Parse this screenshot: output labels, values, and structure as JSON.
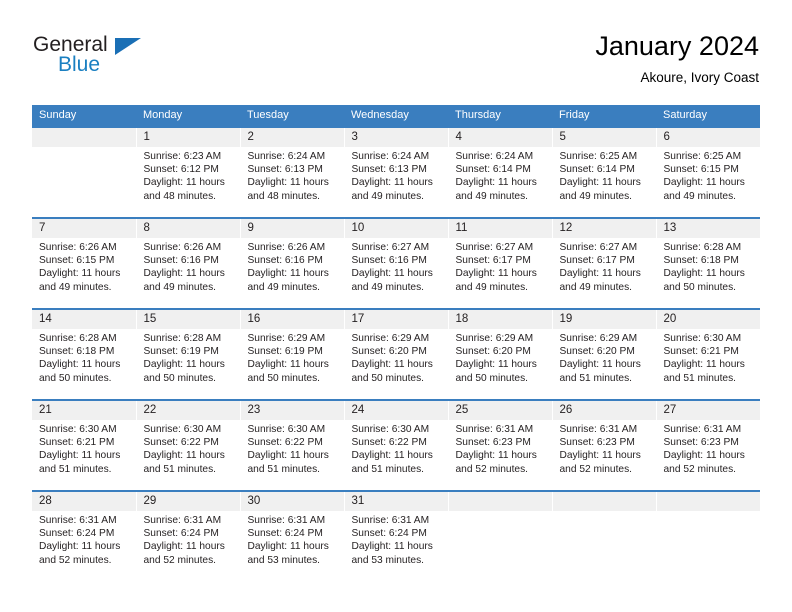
{
  "brand": {
    "name_top": "General",
    "name_bottom": "Blue",
    "color_dark": "#231f20",
    "color_blue": "#1a7fc1",
    "triangle_icon": "triangle-icon"
  },
  "header": {
    "title": "January 2024",
    "subtitle": "Akoure, Ivory Coast"
  },
  "theme": {
    "header_bg": "#3a7ebf",
    "header_text": "#ffffff",
    "daynum_bg": "#f0f0f0",
    "cell_bg": "#ffffff",
    "text": "#231f20"
  },
  "weekdays": [
    "Sunday",
    "Monday",
    "Tuesday",
    "Wednesday",
    "Thursday",
    "Friday",
    "Saturday"
  ],
  "weeks": [
    [
      {
        "day": "",
        "sunrise": "",
        "sunset": "",
        "daylight": "",
        "empty": true
      },
      {
        "day": "1",
        "sunrise": "Sunrise: 6:23 AM",
        "sunset": "Sunset: 6:12 PM",
        "daylight": "Daylight: 11 hours and 48 minutes."
      },
      {
        "day": "2",
        "sunrise": "Sunrise: 6:24 AM",
        "sunset": "Sunset: 6:13 PM",
        "daylight": "Daylight: 11 hours and 48 minutes."
      },
      {
        "day": "3",
        "sunrise": "Sunrise: 6:24 AM",
        "sunset": "Sunset: 6:13 PM",
        "daylight": "Daylight: 11 hours and 49 minutes."
      },
      {
        "day": "4",
        "sunrise": "Sunrise: 6:24 AM",
        "sunset": "Sunset: 6:14 PM",
        "daylight": "Daylight: 11 hours and 49 minutes."
      },
      {
        "day": "5",
        "sunrise": "Sunrise: 6:25 AM",
        "sunset": "Sunset: 6:14 PM",
        "daylight": "Daylight: 11 hours and 49 minutes."
      },
      {
        "day": "6",
        "sunrise": "Sunrise: 6:25 AM",
        "sunset": "Sunset: 6:15 PM",
        "daylight": "Daylight: 11 hours and 49 minutes."
      }
    ],
    [
      {
        "day": "7",
        "sunrise": "Sunrise: 6:26 AM",
        "sunset": "Sunset: 6:15 PM",
        "daylight": "Daylight: 11 hours and 49 minutes."
      },
      {
        "day": "8",
        "sunrise": "Sunrise: 6:26 AM",
        "sunset": "Sunset: 6:16 PM",
        "daylight": "Daylight: 11 hours and 49 minutes."
      },
      {
        "day": "9",
        "sunrise": "Sunrise: 6:26 AM",
        "sunset": "Sunset: 6:16 PM",
        "daylight": "Daylight: 11 hours and 49 minutes."
      },
      {
        "day": "10",
        "sunrise": "Sunrise: 6:27 AM",
        "sunset": "Sunset: 6:16 PM",
        "daylight": "Daylight: 11 hours and 49 minutes."
      },
      {
        "day": "11",
        "sunrise": "Sunrise: 6:27 AM",
        "sunset": "Sunset: 6:17 PM",
        "daylight": "Daylight: 11 hours and 49 minutes."
      },
      {
        "day": "12",
        "sunrise": "Sunrise: 6:27 AM",
        "sunset": "Sunset: 6:17 PM",
        "daylight": "Daylight: 11 hours and 49 minutes."
      },
      {
        "day": "13",
        "sunrise": "Sunrise: 6:28 AM",
        "sunset": "Sunset: 6:18 PM",
        "daylight": "Daylight: 11 hours and 50 minutes."
      }
    ],
    [
      {
        "day": "14",
        "sunrise": "Sunrise: 6:28 AM",
        "sunset": "Sunset: 6:18 PM",
        "daylight": "Daylight: 11 hours and 50 minutes."
      },
      {
        "day": "15",
        "sunrise": "Sunrise: 6:28 AM",
        "sunset": "Sunset: 6:19 PM",
        "daylight": "Daylight: 11 hours and 50 minutes."
      },
      {
        "day": "16",
        "sunrise": "Sunrise: 6:29 AM",
        "sunset": "Sunset: 6:19 PM",
        "daylight": "Daylight: 11 hours and 50 minutes."
      },
      {
        "day": "17",
        "sunrise": "Sunrise: 6:29 AM",
        "sunset": "Sunset: 6:20 PM",
        "daylight": "Daylight: 11 hours and 50 minutes."
      },
      {
        "day": "18",
        "sunrise": "Sunrise: 6:29 AM",
        "sunset": "Sunset: 6:20 PM",
        "daylight": "Daylight: 11 hours and 50 minutes."
      },
      {
        "day": "19",
        "sunrise": "Sunrise: 6:29 AM",
        "sunset": "Sunset: 6:20 PM",
        "daylight": "Daylight: 11 hours and 51 minutes."
      },
      {
        "day": "20",
        "sunrise": "Sunrise: 6:30 AM",
        "sunset": "Sunset: 6:21 PM",
        "daylight": "Daylight: 11 hours and 51 minutes."
      }
    ],
    [
      {
        "day": "21",
        "sunrise": "Sunrise: 6:30 AM",
        "sunset": "Sunset: 6:21 PM",
        "daylight": "Daylight: 11 hours and 51 minutes."
      },
      {
        "day": "22",
        "sunrise": "Sunrise: 6:30 AM",
        "sunset": "Sunset: 6:22 PM",
        "daylight": "Daylight: 11 hours and 51 minutes."
      },
      {
        "day": "23",
        "sunrise": "Sunrise: 6:30 AM",
        "sunset": "Sunset: 6:22 PM",
        "daylight": "Daylight: 11 hours and 51 minutes."
      },
      {
        "day": "24",
        "sunrise": "Sunrise: 6:30 AM",
        "sunset": "Sunset: 6:22 PM",
        "daylight": "Daylight: 11 hours and 51 minutes."
      },
      {
        "day": "25",
        "sunrise": "Sunrise: 6:31 AM",
        "sunset": "Sunset: 6:23 PM",
        "daylight": "Daylight: 11 hours and 52 minutes."
      },
      {
        "day": "26",
        "sunrise": "Sunrise: 6:31 AM",
        "sunset": "Sunset: 6:23 PM",
        "daylight": "Daylight: 11 hours and 52 minutes."
      },
      {
        "day": "27",
        "sunrise": "Sunrise: 6:31 AM",
        "sunset": "Sunset: 6:23 PM",
        "daylight": "Daylight: 11 hours and 52 minutes."
      }
    ],
    [
      {
        "day": "28",
        "sunrise": "Sunrise: 6:31 AM",
        "sunset": "Sunset: 6:24 PM",
        "daylight": "Daylight: 11 hours and 52 minutes."
      },
      {
        "day": "29",
        "sunrise": "Sunrise: 6:31 AM",
        "sunset": "Sunset: 6:24 PM",
        "daylight": "Daylight: 11 hours and 52 minutes."
      },
      {
        "day": "30",
        "sunrise": "Sunrise: 6:31 AM",
        "sunset": "Sunset: 6:24 PM",
        "daylight": "Daylight: 11 hours and 53 minutes."
      },
      {
        "day": "31",
        "sunrise": "Sunrise: 6:31 AM",
        "sunset": "Sunset: 6:24 PM",
        "daylight": "Daylight: 11 hours and 53 minutes."
      },
      {
        "day": "",
        "sunrise": "",
        "sunset": "",
        "daylight": "",
        "empty": true
      },
      {
        "day": "",
        "sunrise": "",
        "sunset": "",
        "daylight": "",
        "empty": true
      },
      {
        "day": "",
        "sunrise": "",
        "sunset": "",
        "daylight": "",
        "empty": true
      }
    ]
  ]
}
